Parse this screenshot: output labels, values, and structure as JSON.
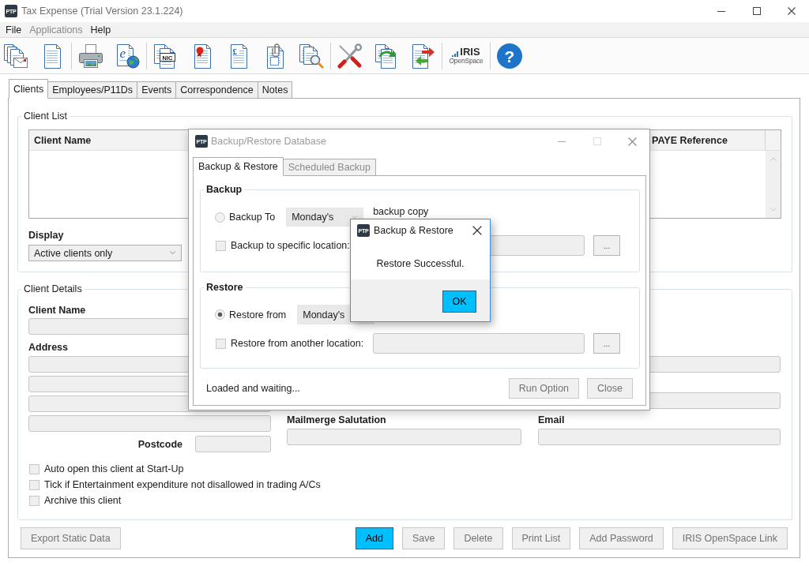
{
  "window": {
    "app_logo": "PTP",
    "title": "Tax Expense (Trial Version 23.1.224)"
  },
  "menu": [
    {
      "label": "File",
      "disabled": false
    },
    {
      "label": "Applications",
      "disabled": true
    },
    {
      "label": "Help",
      "disabled": false
    }
  ],
  "toolbar": {
    "groups": [
      {
        "items": [
          {
            "kind": "letters"
          },
          {
            "kind": "page"
          }
        ]
      },
      {
        "items": [
          {
            "kind": "printer"
          },
          {
            "kind": "web-page",
            "mark": "e"
          }
        ]
      },
      {
        "items": [
          {
            "kind": "nic-page",
            "mark": "NIC"
          },
          {
            "kind": "seal-page"
          },
          {
            "kind": "pound-page",
            "mark": "£"
          },
          {
            "kind": "clip-page"
          },
          {
            "kind": "search-page"
          }
        ]
      },
      {
        "items": [
          {
            "kind": "tools"
          },
          {
            "kind": "refresh-page"
          },
          {
            "kind": "export-page"
          }
        ]
      },
      {
        "items": [
          {
            "kind": "logo",
            "title": "IRIS",
            "subtitle": "OpenSpace"
          }
        ]
      },
      {
        "items": [
          {
            "kind": "help",
            "mark": "?"
          }
        ]
      }
    ]
  },
  "tabs": [
    {
      "label": "Clients",
      "selected": true
    },
    {
      "label": "Employees/P11Ds",
      "selected": false
    },
    {
      "label": "Events",
      "selected": false
    },
    {
      "label": "Correspondence",
      "selected": false
    },
    {
      "label": "Notes",
      "selected": false
    }
  ],
  "client_list": {
    "title": "Client List",
    "columns": [
      "Client Name",
      "PAYE Reference"
    ],
    "display_label": "Display",
    "display_value": "Active clients only"
  },
  "client_details": {
    "title": "Client Details",
    "client_name_label": "Client Name",
    "address_label": "Address",
    "postcode_label": "Postcode",
    "salutation_label": "Mailmerge Salutation",
    "email_label": "Email",
    "options": [
      {
        "label": "Auto open this client at Start-Up",
        "checked": false
      },
      {
        "label": "Tick if Entertainment expenditure not disallowed in trading A/Cs",
        "checked": false
      },
      {
        "label": "Archive this client",
        "checked": false
      }
    ]
  },
  "left_buttons": [
    {
      "label": "Export Static Data",
      "disabled": true,
      "primary": false
    }
  ],
  "right_buttons": [
    {
      "label": "Add",
      "disabled": false,
      "primary": true
    },
    {
      "label": "Save",
      "disabled": true,
      "primary": false
    },
    {
      "label": "Delete",
      "disabled": true,
      "primary": false
    },
    {
      "label": "Print List",
      "disabled": true,
      "primary": false
    },
    {
      "label": "Add Password",
      "disabled": true,
      "primary": false
    },
    {
      "label": "IRIS OpenSpace Link",
      "disabled": true,
      "primary": false
    }
  ],
  "backup_dialog": {
    "app_logo": "PTP",
    "title": "Backup/Restore Database",
    "tabs": [
      {
        "label": "Backup & Restore",
        "selected": true,
        "disabled": false
      },
      {
        "label": "Scheduled Backup",
        "selected": false,
        "disabled": true
      }
    ],
    "backup": {
      "title": "Backup",
      "radio": {
        "label": "Backup To",
        "selected": false
      },
      "select_value": "Monday's",
      "suffix": "backup copy",
      "location": {
        "label": "Backup to specific location:",
        "checked": false,
        "browse": "..."
      }
    },
    "restore": {
      "title": "Restore",
      "radio": {
        "label": "Restore from",
        "selected": true
      },
      "select_value": "Monday's",
      "location": {
        "label": "Restore from another location:",
        "checked": false,
        "browse": "..."
      }
    },
    "status": "Loaded and waiting...",
    "buttons": [
      {
        "label": "Run Option",
        "disabled": true
      },
      {
        "label": "Close",
        "disabled": true
      }
    ]
  },
  "message_box": {
    "app_logo": "PTP",
    "title": "Backup & Restore",
    "message": "Restore Successful.",
    "button": {
      "label": "OK",
      "primary": true
    }
  }
}
